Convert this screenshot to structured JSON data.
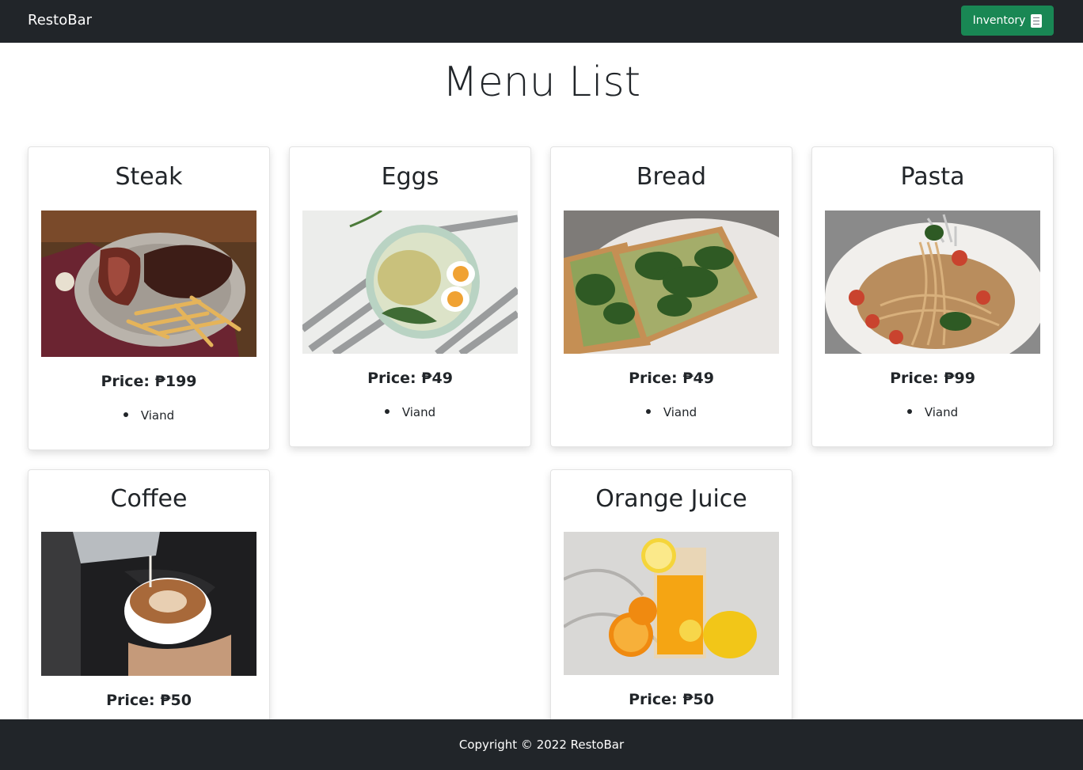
{
  "navbar": {
    "brand": "RestoBar",
    "inventory_label": "Inventory"
  },
  "page": {
    "title": "Menu List"
  },
  "menu": [
    {
      "name": "Steak",
      "price": "Price: ₱199",
      "category": "Viand"
    },
    {
      "name": "Eggs",
      "price": "Price: ₱49",
      "category": "Viand"
    },
    {
      "name": "Bread",
      "price": "Price: ₱49",
      "category": "Viand"
    },
    {
      "name": "Pasta",
      "price": "Price: ₱99",
      "category": "Viand"
    },
    {
      "name": "Coffee",
      "price": "Price: ₱50"
    },
    {
      "name": "Orange Juice",
      "price": "Price: ₱50"
    }
  ],
  "footer": {
    "copyright": "Copyright © 2022 RestoBar"
  },
  "colors": {
    "navbar": "#212529",
    "button": "#198754"
  }
}
